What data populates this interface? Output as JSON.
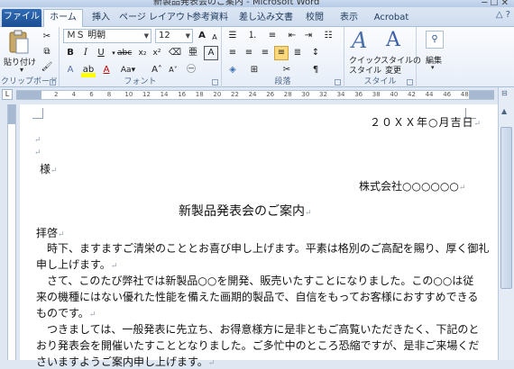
{
  "window": {
    "title_fragment": "新製品発表会のご案内 - Microsoft Word",
    "controls": "─ ☐ ✕"
  },
  "tabs": [
    {
      "label": "ファイル"
    },
    {
      "label": "ホーム"
    },
    {
      "label": "挿入"
    },
    {
      "label": "ページ レイアウト"
    },
    {
      "label": "参考資料"
    },
    {
      "label": "差し込み文書"
    },
    {
      "label": "校閲"
    },
    {
      "label": "表示"
    },
    {
      "label": "Acrobat"
    }
  ],
  "ribbon_right": {
    "help": "△ ?"
  },
  "clipboard": {
    "paste_label": "貼り付け",
    "group_label": "クリップボード"
  },
  "font": {
    "name": "ＭＳ 明朝",
    "size": "12",
    "group_label": "フォント",
    "aa": "Aa▾",
    "grow": "A",
    "shrink": "A",
    "phonetic": "亜",
    "border_a": "A"
  },
  "paragraph": {
    "group_label": "段落"
  },
  "styles": {
    "quick_label_1": "クイック",
    "quick_label_2": "スタイル",
    "change_label_1": "スタイルの",
    "change_label_2": "変更",
    "group_label": "スタイル"
  },
  "editing": {
    "label": "編集"
  },
  "ruler": {
    "numbers": [
      "2",
      "4",
      "6",
      "8",
      "10",
      "12",
      "14",
      "16",
      "18",
      "20",
      "22",
      "24",
      "26",
      "28",
      "30",
      "32",
      "34",
      "36",
      "38",
      "40",
      "42",
      "44",
      "46",
      "48"
    ]
  },
  "document": {
    "date": "２０ＸＸ年○月吉日",
    "addressee": "様",
    "sender": "株式会社○○○○○○",
    "title": "新製品発表会のご案内",
    "greeting": "拝啓",
    "lines": [
      "　時下、ますますご清栄のこととお喜び申し上げます。平素は格別のご高配を賜り、厚く御礼",
      "申し上げます。",
      "　さて、このたび弊社では新製品○○を開発、販売いたすことになりました。この○○は従",
      "来の機種にはない優れた性能を備えた画期的製品で、自信をもってお客様におすすめできる",
      "ものです。",
      "　つきましては、一般発表に先立ち、お得意様方に是非ともご高覧いただきたく、下記のと",
      "おり発表会を開催いたすこととなりました。ご多忙中のところ恐縮ですが、是非ご来場くだ",
      "さいますようご案内申し上げます。"
    ]
  }
}
